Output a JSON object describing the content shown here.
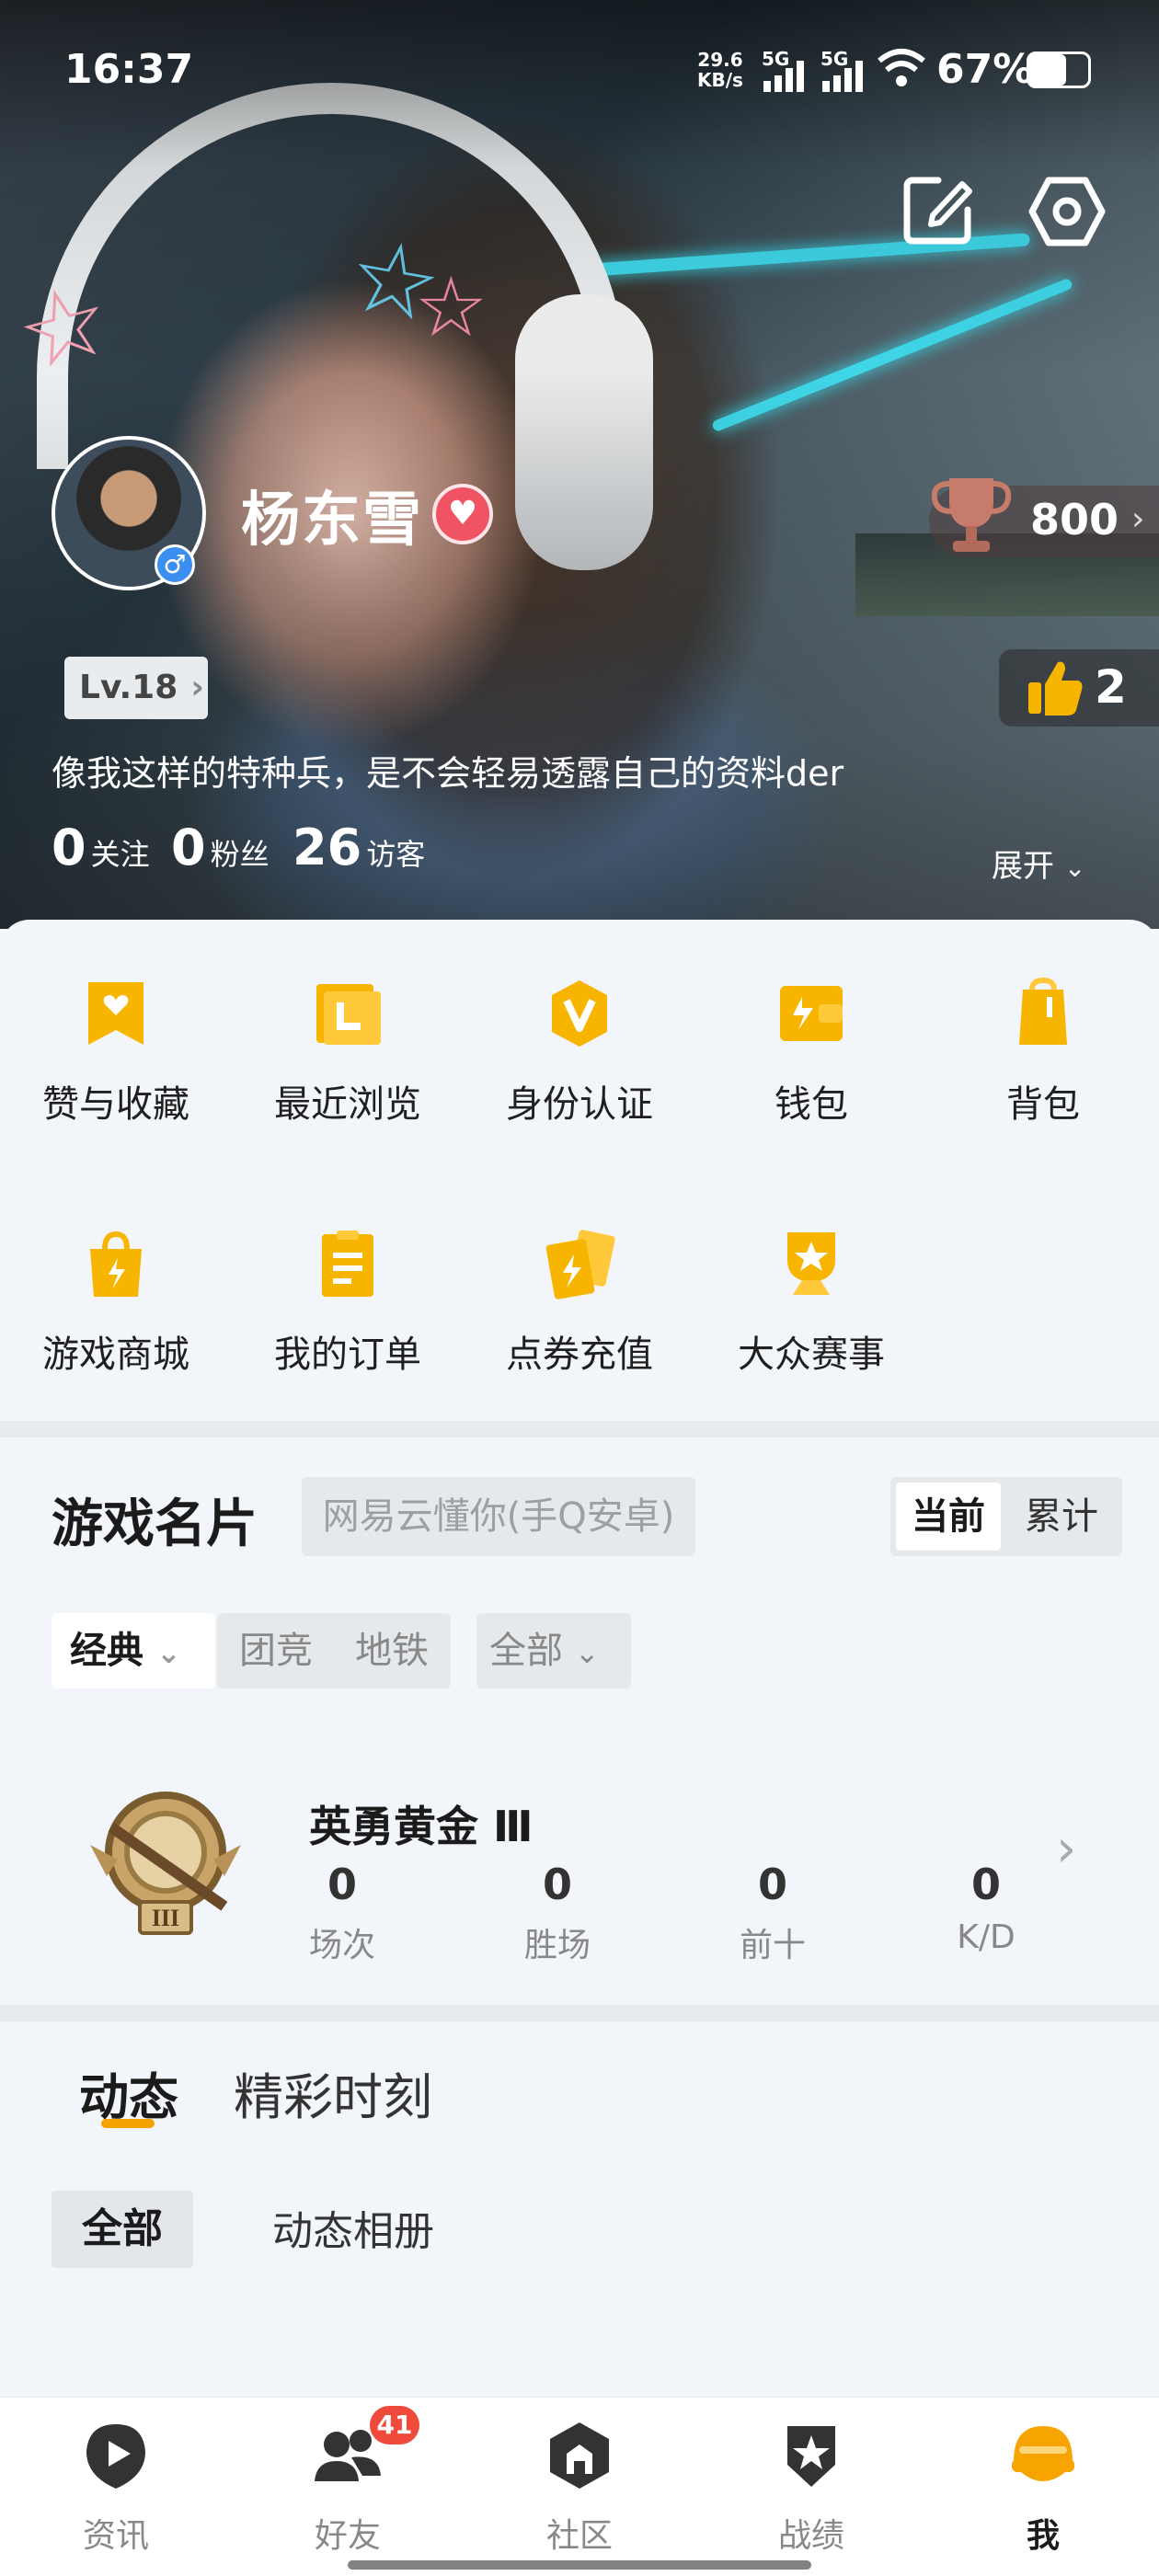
{
  "status_bar": {
    "time": "16:37",
    "net_speed_top": "29.6",
    "net_speed_unit": "KB/s",
    "signal1": "5G",
    "signal2": "5G",
    "battery": "67%"
  },
  "profile": {
    "name": "杨东雪",
    "level": "Lv.18",
    "bio": "像我这样的特种兵，是不会轻易透露自己的资料der",
    "trophy_score": "800",
    "likes": "2",
    "stats": [
      {
        "num": "0",
        "label": "关注"
      },
      {
        "num": "0",
        "label": "粉丝"
      },
      {
        "num": "26",
        "label": "访客"
      }
    ],
    "expand_label": "展开"
  },
  "grid": [
    {
      "label": "赞与收藏",
      "icon": "heart-bookmark-icon"
    },
    {
      "label": "最近浏览",
      "icon": "history-icon"
    },
    {
      "label": "身份认证",
      "icon": "verify-badge-icon"
    },
    {
      "label": "钱包",
      "icon": "wallet-icon"
    },
    {
      "label": "背包",
      "icon": "backpack-icon"
    },
    {
      "label": "游戏商城",
      "icon": "shop-bag-icon"
    },
    {
      "label": "我的订单",
      "icon": "order-list-icon"
    },
    {
      "label": "点券充值",
      "icon": "coupon-recharge-icon"
    },
    {
      "label": "大众赛事",
      "icon": "tournament-trophy-icon"
    }
  ],
  "game_card": {
    "title": "游戏名片",
    "account": "网易云懂你(手Q安卓)",
    "seg_current": "当前",
    "seg_total": "累计",
    "filter_mode": "经典",
    "filter_team": "团竞",
    "filter_metro": "地铁",
    "filter_all": "全部",
    "rank_name": "英勇黄金 Ⅲ",
    "stats": [
      {
        "num": "0",
        "label": "场次"
      },
      {
        "num": "0",
        "label": "胜场"
      },
      {
        "num": "0",
        "label": "前十"
      },
      {
        "num": "0",
        "label": "K/D"
      }
    ]
  },
  "feed": {
    "tab_active": "动态",
    "tab_other": "精彩时刻",
    "chip_active": "全部",
    "chip_other": "动态相册"
  },
  "nav": [
    {
      "label": "资讯",
      "icon": "news-play-icon"
    },
    {
      "label": "好友",
      "icon": "friends-icon",
      "badge": "41"
    },
    {
      "label": "社区",
      "icon": "community-icon"
    },
    {
      "label": "战绩",
      "icon": "record-badge-icon"
    },
    {
      "label": "我",
      "icon": "me-helmet-icon"
    }
  ],
  "colors": {
    "accent": "#f5a300",
    "icon_yellow": "#f7b500",
    "heart": "#f05363",
    "badge": "#f04a3c"
  }
}
